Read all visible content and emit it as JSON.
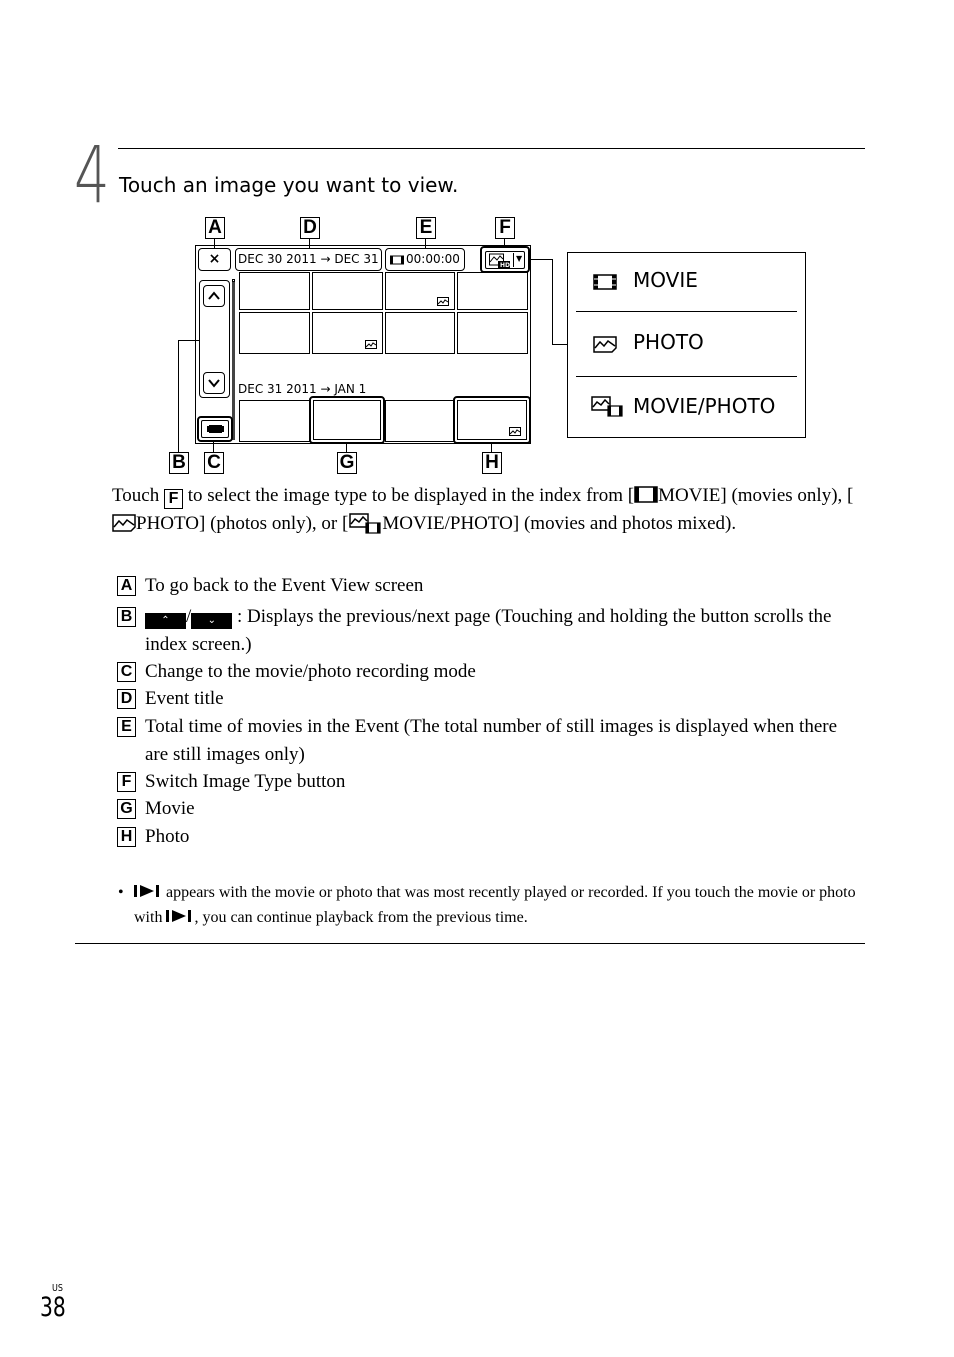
{
  "step": {
    "number": "4",
    "instruction": "Touch an image you want to view."
  },
  "diagram": {
    "callouts": {
      "A": "A",
      "B": "B",
      "C": "C",
      "D": "D",
      "E": "E",
      "F": "F",
      "G": "G",
      "H": "H"
    },
    "close_button_label": "×",
    "event_title_1": "DEC 30 2011 → DEC 31",
    "total_time": "00:00:00",
    "event_title_2": "DEC 31 2011 → JAN 1",
    "image_type_icon": "movie-photo-hd-icon",
    "menu": [
      {
        "label": "MOVIE",
        "icon": "film-icon"
      },
      {
        "label": "PHOTO",
        "icon": "photo-icon"
      },
      {
        "label": "MOVIE/PHOTO",
        "icon": "movie-photo-icon"
      }
    ]
  },
  "paragraph": {
    "touch": "Touch",
    "badge": "F",
    "part1": "to select the image type to be displayed in the index from [",
    "movie": "MOVIE]",
    "part2": "(movies only), [",
    "photo": "PHOTO] (photos only), or [",
    "movie_photo": "MOVIE/PHOTO] (movies and photos mixed)."
  },
  "legend": [
    {
      "key": "A",
      "text": "To go back to the Event View screen"
    },
    {
      "key": "B",
      "text": ": Displays the previous/next page (Touching and holding the button scrolls the index screen.)",
      "btn_prev": "⌃",
      "btn_next": "⌄"
    },
    {
      "key": "C",
      "text": "Change to the movie/photo recording mode"
    },
    {
      "key": "D",
      "text": "Event title"
    },
    {
      "key": "E",
      "text": "Total time of movies in the Event (The total number of still images is displayed when there are still images only)"
    },
    {
      "key": "F",
      "text": "Switch Image Type button"
    },
    {
      "key": "G",
      "text": "Movie"
    },
    {
      "key": "H",
      "text": "Photo"
    }
  ],
  "note": {
    "bullet": "•",
    "icon": "resume-playback-icon",
    "text1": "appears with the movie or photo that was most recently played or recorded. If you touch the movie or photo with",
    "text2": ", you can continue playback from the previous time."
  },
  "footer": {
    "region": "US",
    "page_number": "38"
  }
}
